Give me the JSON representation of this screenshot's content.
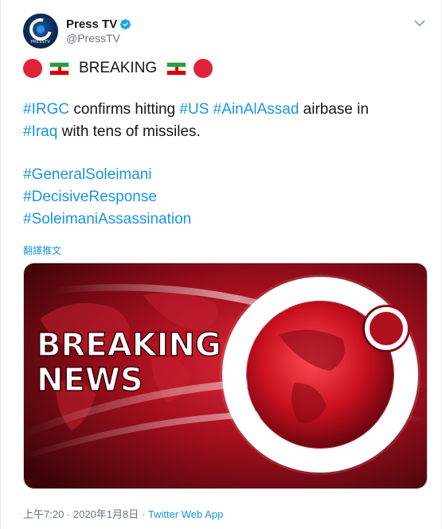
{
  "account": {
    "display_name": "Press TV",
    "handle": "@PressTV",
    "avatar_text": "PRESSTV"
  },
  "tweet": {
    "breaking_label": "BREAKING",
    "line1_tags_and_text": [
      {
        "t": "#IRGC",
        "tag": true
      },
      {
        "t": " confirms hitting ",
        "tag": false
      },
      {
        "t": "#US",
        "tag": true
      },
      {
        "t": " ",
        "tag": false
      },
      {
        "t": "#AinAlAssad",
        "tag": true
      },
      {
        "t": " airbase in",
        "tag": false
      }
    ],
    "line2_tags_and_text": [
      {
        "t": "#Iraq",
        "tag": true
      },
      {
        "t": " with tens of missiles.",
        "tag": false
      }
    ],
    "hashtags": [
      "#GeneralSoleimani",
      "#DecisiveResponse",
      "#SoleimaniAssassination"
    ],
    "translate_label": "翻譯推文"
  },
  "media": {
    "headline_line1": "BREAKING",
    "headline_line2": "NEWS"
  },
  "footer": {
    "time": "上午7:20",
    "date": "2020年1月8日",
    "separator": " · ",
    "source": "Twitter Web App"
  },
  "colors": {
    "link": "#1b95e0",
    "breaking_red": "#e0233a",
    "text": "#14171a",
    "muted": "#657786"
  }
}
